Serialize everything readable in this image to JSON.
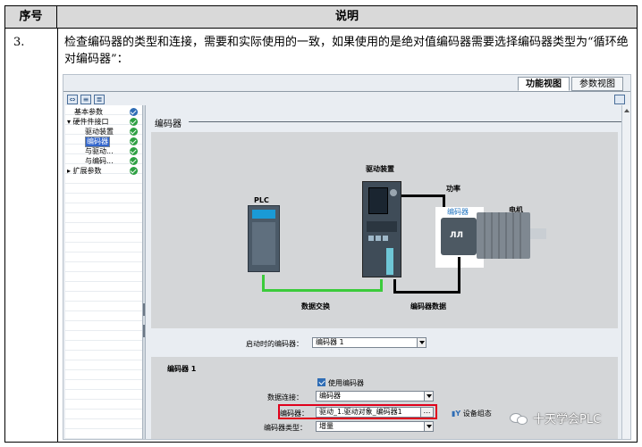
{
  "table": {
    "col_seq": "序号",
    "col_desc": "说明",
    "step_number": "3.",
    "step_text": "检查编码器的类型和连接，需要和实际使用的一致，如果使用的是绝对值编码器需要选择编码器类型为“循环绝对编码器”："
  },
  "screenshot": {
    "tabs": [
      {
        "label": "功能视图",
        "active": true
      },
      {
        "label": "参数视图",
        "active": false
      }
    ],
    "tree": [
      {
        "label": "基本参数",
        "status": "blue",
        "indent": 1
      },
      {
        "label": "▾ 硬件件接口",
        "status": "green",
        "indent": 0
      },
      {
        "label": "驱动装置",
        "status": "green",
        "indent": 2
      },
      {
        "label": "编码器",
        "status": "green",
        "indent": 2,
        "selected": true
      },
      {
        "label": "与驱动...",
        "status": "green",
        "indent": 2
      },
      {
        "label": "与编码...",
        "status": "green",
        "indent": 2
      },
      {
        "label": "▸ 扩展参数",
        "status": "green",
        "indent": 0
      }
    ],
    "section_title": "编码器",
    "diagram": {
      "drive_label": "驱动装置",
      "power_label": "功率",
      "plc_label": "PLC",
      "encoder_label": "编码器",
      "motor_label": "电机",
      "data_exchange_label": "数据交换",
      "encoder_data_label": "编码器数据"
    },
    "active_encoder": {
      "label": "启动时的编码器：",
      "value": "编码器 1"
    },
    "group": {
      "title": "编码器 1",
      "use_encoder_label": "使用编码器",
      "use_encoder_checked": true,
      "data_connection_label": "数据连接：",
      "data_connection_value": "编码器",
      "encoder_label": "编码器：",
      "encoder_value": "驱动_1.驱动对象_编码器1",
      "encoder_type_label": "编码器类型：",
      "encoder_type_value": "增量",
      "device_config_label": "设备组态"
    }
  },
  "watermark": "十天学会PLC",
  "colors": {
    "highlight_red": "#e0001b",
    "green_arrow": "#3bcb3b",
    "check_green": "#2ea043",
    "selection_blue": "#3366cc"
  }
}
